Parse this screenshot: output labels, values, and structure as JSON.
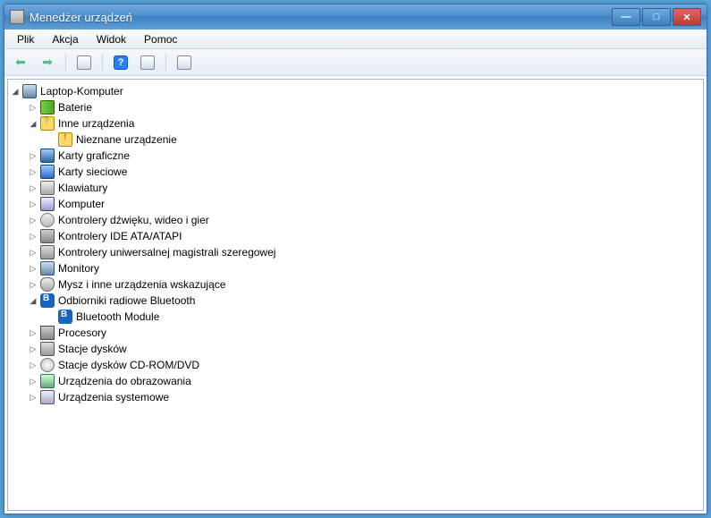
{
  "window": {
    "title": "Menedżer urządzeń"
  },
  "menu": {
    "file": "Plik",
    "action": "Akcja",
    "view": "Widok",
    "help": "Pomoc"
  },
  "tree": {
    "root": "Laptop-Komputer",
    "baterie": "Baterie",
    "inne": "Inne urządzenia",
    "nieznane": "Nieznane urządzenie",
    "karty_graficzne": "Karty graficzne",
    "karty_sieciowe": "Karty sieciowe",
    "klawiatury": "Klawiatury",
    "komputer": "Komputer",
    "kontrolery_dzwieku": "Kontrolery dźwięku, wideo i gier",
    "kontrolery_ide": "Kontrolery IDE ATA/ATAPI",
    "kontrolery_usb": "Kontrolery uniwersalnej magistrali szeregowej",
    "monitory": "Monitory",
    "mysz": "Mysz i inne urządzenia wskazujące",
    "bt": "Odbiorniki radiowe Bluetooth",
    "bt_module": "Bluetooth Module",
    "procesory": "Procesory",
    "stacje_dyskow": "Stacje dysków",
    "stacje_cd": "Stacje dysków CD-ROM/DVD",
    "obrazowanie": "Urządzenia do obrazowania",
    "systemowe": "Urządzenia systemowe"
  }
}
